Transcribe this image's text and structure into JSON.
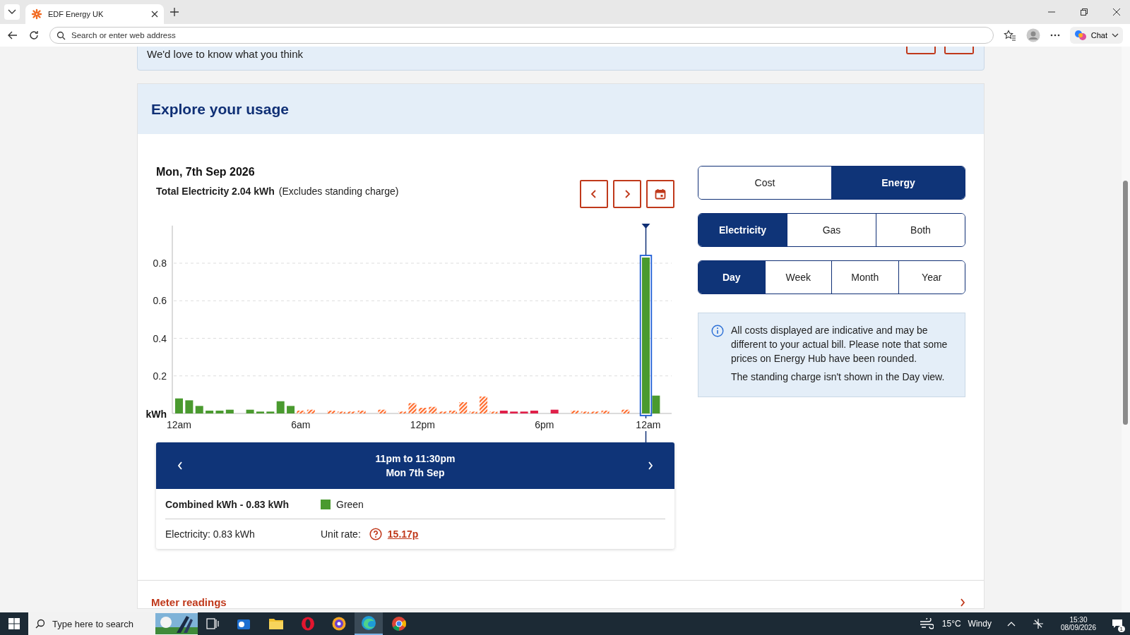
{
  "browser": {
    "tab_title": "EDF Energy UK",
    "address_placeholder": "Search or enter web address",
    "chat_label": "Chat"
  },
  "feedback": {
    "text": "We'd love to know what you think"
  },
  "usage": {
    "title": "Explore your usage",
    "date": "Mon, 7th Sep 2026",
    "total_label": "Total Electricity 2.04 kWh",
    "total_note": "(Excludes standing charge)",
    "measure_tabs": [
      {
        "label": "Cost",
        "selected": false
      },
      {
        "label": "Energy",
        "selected": true
      }
    ],
    "fuel_tabs": [
      {
        "label": "Electricity",
        "selected": true
      },
      {
        "label": "Gas",
        "selected": false
      },
      {
        "label": "Both",
        "selected": false
      }
    ],
    "period_tabs": [
      {
        "label": "Day",
        "selected": true
      },
      {
        "label": "Week",
        "selected": false
      },
      {
        "label": "Month",
        "selected": false
      },
      {
        "label": "Year",
        "selected": false
      }
    ],
    "info": [
      "All costs displayed are indicative and may be different to your actual bill. Please note that some prices on Energy Hub have been rounded.",
      "The standing charge isn't shown in the Day view."
    ],
    "axis_end_label": "12am",
    "chart_data": {
      "type": "bar",
      "ylabel": "kWh",
      "stacked": true,
      "grid": true,
      "ylim": [
        0,
        1
      ],
      "yticks": [
        0.2,
        0.4,
        0.6,
        0.8
      ],
      "categories": [
        "12am",
        null,
        null,
        null,
        null,
        null,
        null,
        null,
        null,
        null,
        null,
        null,
        "6am",
        null,
        null,
        null,
        null,
        null,
        null,
        null,
        null,
        null,
        null,
        null,
        "12pm",
        null,
        null,
        null,
        null,
        null,
        null,
        null,
        null,
        null,
        null,
        null,
        "6pm",
        null,
        null,
        null,
        null,
        null,
        null,
        null,
        null,
        null,
        null,
        null
      ],
      "series": [
        {
          "color": "#4a9a2f",
          "values": [
            0.08,
            0.07,
            0.04,
            0.015,
            0.015,
            0.02,
            null,
            0.02,
            0.01,
            0.01,
            0.065,
            0.04,
            null,
            null,
            null,
            null,
            null,
            null,
            null,
            null,
            null,
            null,
            null,
            null,
            null,
            null,
            null,
            null,
            null,
            null,
            null,
            null,
            null,
            null,
            null,
            null,
            null,
            null,
            null,
            null,
            null,
            null,
            null,
            null,
            null,
            null,
            0.83,
            0.095
          ]
        },
        {
          "color": "#ff6a2b",
          "values": [
            null,
            null,
            null,
            null,
            null,
            null,
            null,
            null,
            null,
            null,
            null,
            null,
            0.015,
            0.02,
            null,
            0.015,
            0.01,
            0.01,
            0.015,
            null,
            0.02,
            null,
            0.01,
            0.055,
            0.03,
            0.035,
            0.01,
            0.015,
            0.06,
            0.01,
            0.09,
            0.01,
            null,
            null,
            null,
            null,
            null,
            null,
            null,
            0.015,
            0.01,
            0.01,
            0.015,
            null,
            0.02,
            null,
            null,
            null
          ]
        },
        {
          "color": "#e0204a",
          "values": [
            null,
            null,
            null,
            null,
            null,
            null,
            null,
            null,
            null,
            null,
            null,
            null,
            null,
            null,
            null,
            null,
            null,
            null,
            null,
            null,
            null,
            null,
            null,
            null,
            null,
            null,
            null,
            null,
            null,
            null,
            null,
            null,
            0.015,
            0.01,
            0.01,
            0.015,
            null,
            0.02,
            null,
            null,
            null,
            null,
            null,
            null,
            null,
            null,
            null,
            null
          ]
        }
      ]
    },
    "detail": {
      "range": "11pm to 11:30pm",
      "day": "Mon 7th Sep",
      "combined": "Combined kWh - 0.83 kWh",
      "legend": {
        "label": "Green",
        "color": "#4a9a2f"
      },
      "electricity": "Electricity: 0.83 kWh",
      "unit_rate_label": "Unit rate:",
      "unit_rate": "15.17p"
    }
  },
  "next_section": "Meter readings",
  "taskbar": {
    "search_placeholder": "Type here to search",
    "temperature": "15°C",
    "weather": "Windy",
    "time": "15:30",
    "date": "08/09/2026",
    "notifications": "1"
  }
}
